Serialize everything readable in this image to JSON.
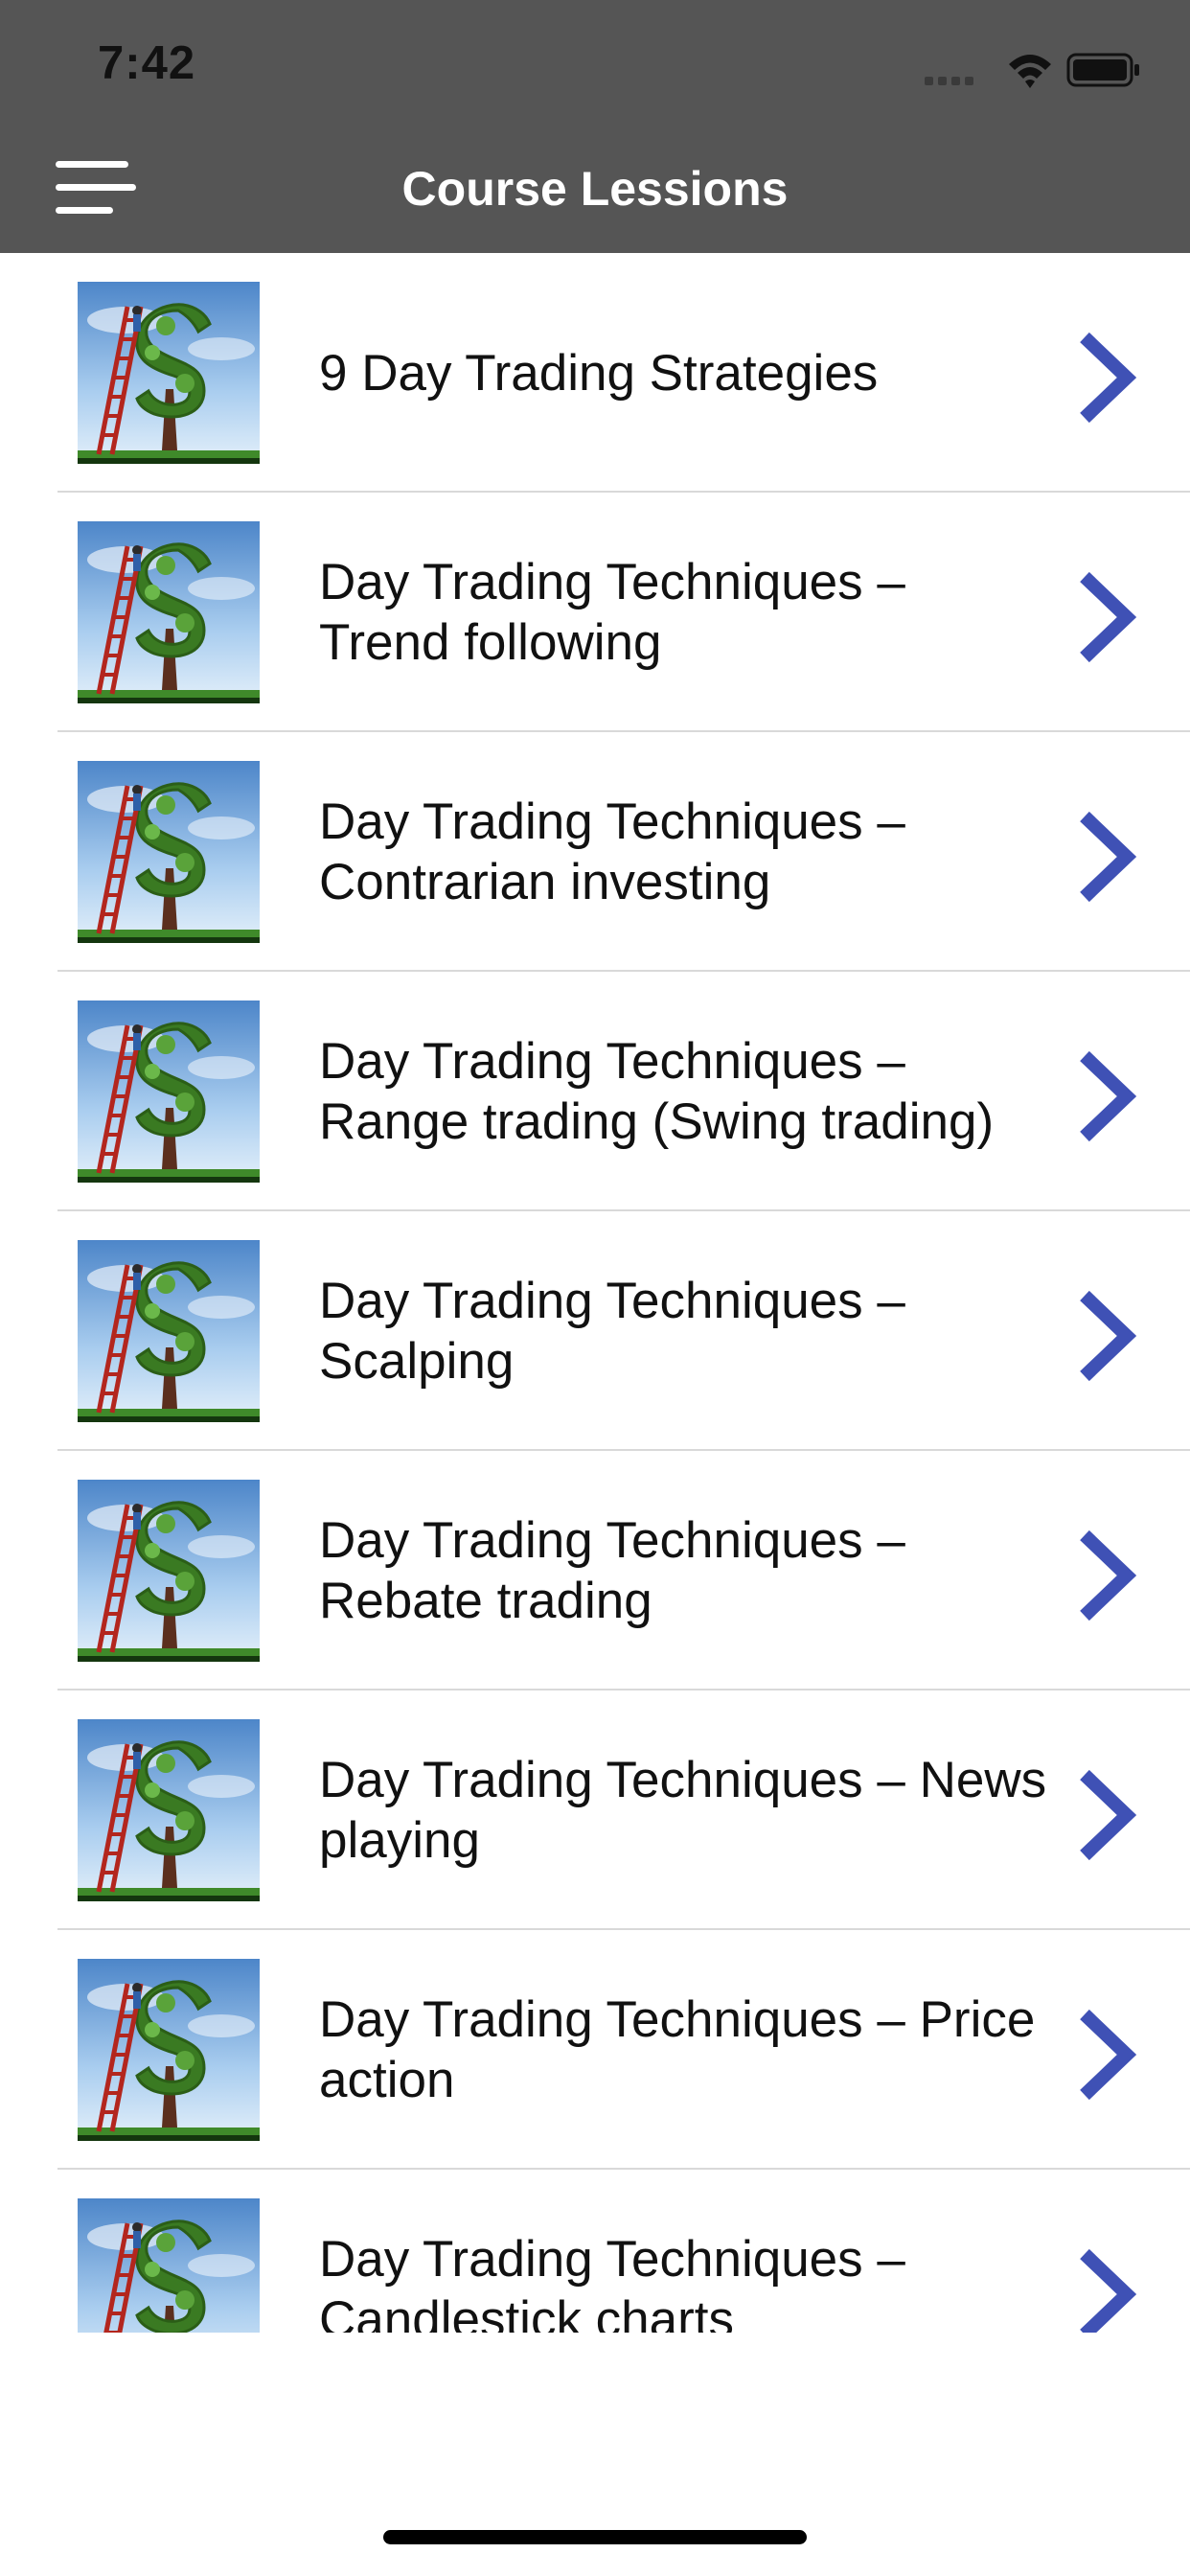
{
  "status_bar": {
    "time": "7:42",
    "icons": [
      "cellular-signal-icon",
      "wifi-icon",
      "battery-icon"
    ]
  },
  "header": {
    "title": "Course Lessions",
    "menu_icon": "hamburger-menu-icon",
    "background": "#555555"
  },
  "lessons": [
    {
      "title": "9 Day Trading Strategies"
    },
    {
      "title": "Day Trading Techniques – Trend following"
    },
    {
      "title": "Day Trading Techniques – Contrarian investing"
    },
    {
      "title": "Day Trading Techniques – Range trading (Swing trading)"
    },
    {
      "title": "Day Trading Techniques – Scalping"
    },
    {
      "title": "Day Trading Techniques – Rebate trading"
    },
    {
      "title": "Day Trading Techniques – News playing"
    },
    {
      "title": "Day Trading Techniques – Price action"
    },
    {
      "title": "Day Trading Techniques – Candlestick charts"
    }
  ],
  "row_icons": {
    "thumbnail": "money-tree-ladder-thumbnail",
    "disclosure": "chevron-right-icon"
  },
  "colors": {
    "chevron": "#3f51b5",
    "divider": "#d9d9d9",
    "header_text": "#ffffff"
  }
}
